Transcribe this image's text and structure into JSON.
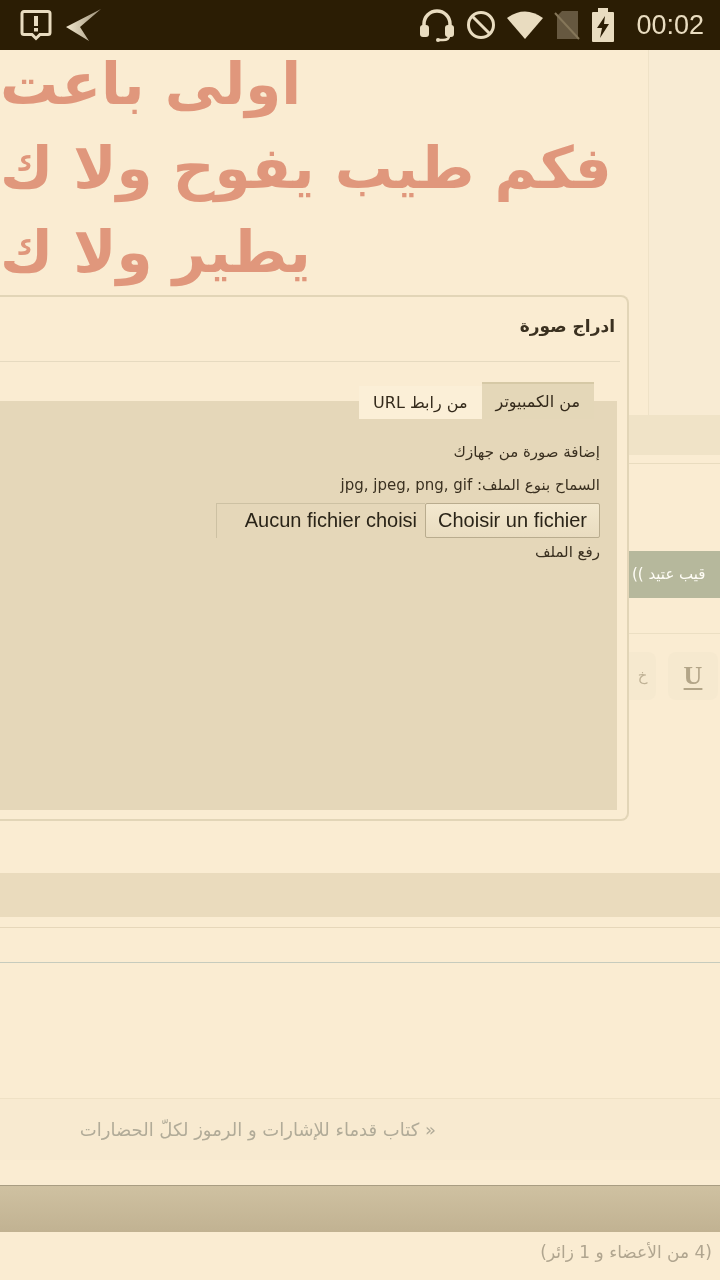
{
  "status_bar": {
    "time": "00:02"
  },
  "header": {
    "lines": [
      "اولى باعت",
      "فكم طيب يفوح ولا ك",
      "يطير ولا ك"
    ]
  },
  "dialog": {
    "title": "ادراج صورة",
    "tabs": [
      {
        "label": "من الكمبيوتر",
        "selected": true
      },
      {
        "label": "من رابط URL",
        "selected": false
      }
    ],
    "panel": {
      "heading": "إضافة صورة من جهازك",
      "allowed_types": "السماح بنوع الملف: jpg, jpeg, png, gif",
      "file_button": "Choisir un fichier",
      "file_status": "Aucun fichier choisi",
      "upload_label": "رفع الملف"
    }
  },
  "page": {
    "banner": "قيب عتيد ))",
    "toolbar": [
      {
        "kind": "underline",
        "label": "U"
      },
      {
        "kind": "text",
        "label": "خ"
      }
    ],
    "next_topic_link": "« كتاب قدماء للإشارات و الرموز لكلّ الحضارات",
    "online_count": "(4 من الأعضاء و 1 زائر)"
  }
}
